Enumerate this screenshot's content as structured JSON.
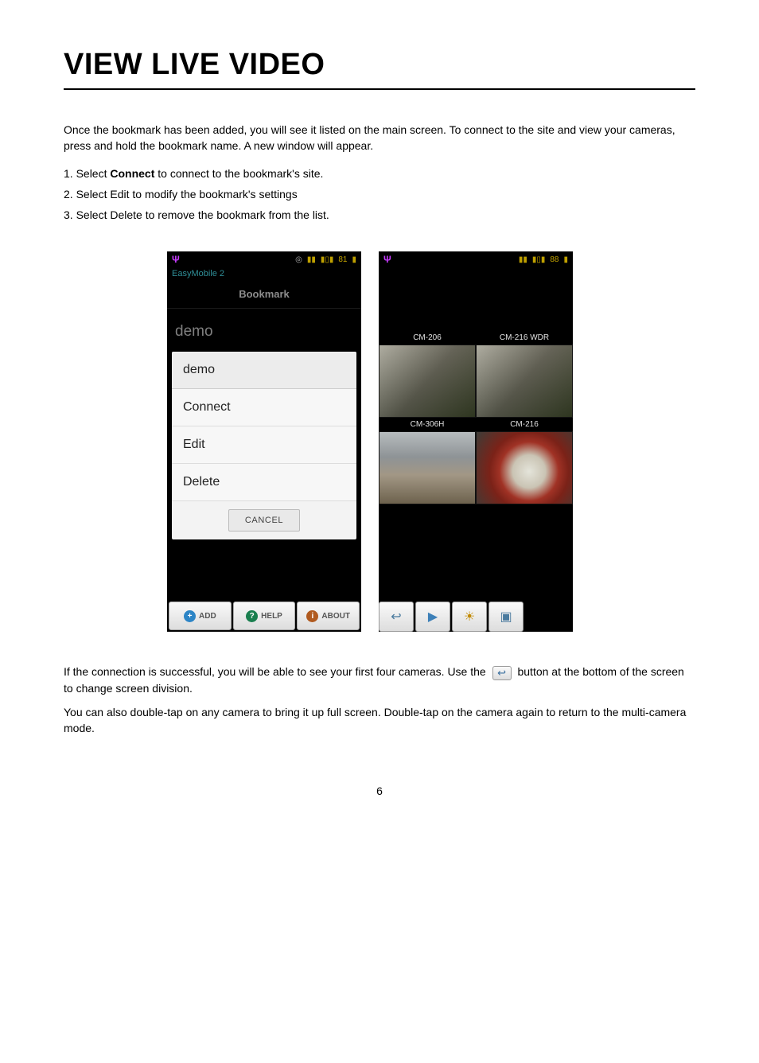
{
  "title": "VIEW LIVE VIDEO",
  "intro": "Once the bookmark has been added, you will see it listed on the main screen. To connect to the site and view your cameras, press and hold the bookmark name. A new window will appear.",
  "keyword_select": "Connect",
  "steps": [
    "1. Select Connect to connect to the bookmark's site.",
    "2. Select Edit to modify the bookmark's settings",
    "3. Select Delete to remove the bookmark from the list."
  ],
  "status_left": {
    "battery": "81"
  },
  "status_right": {
    "battery": "88"
  },
  "left_phone": {
    "app_title": "EasyMobile 2",
    "header": "Bookmark",
    "bookmark_title": "demo",
    "menu": {
      "name": "demo",
      "connect": "Connect",
      "edit": "Edit",
      "delete": "Delete",
      "cancel": "CANCEL"
    },
    "bottom": {
      "add": "ADD",
      "help": "HELP",
      "about": "ABOUT"
    }
  },
  "right_phone": {
    "cams": [
      "CM-206",
      "CM-216 WDR",
      "CM-306H",
      "CM-216"
    ]
  },
  "para2_prefix": "If the connection is successful, you will be able to see your first four cameras. Use the  ",
  "para2_suffix": "  button at the bottom of the screen to change screen division.",
  "para3": "You can also double-tap on any camera to bring it up full screen. Double-tap on the camera again to return to the multi-camera mode.",
  "page_number": "6"
}
